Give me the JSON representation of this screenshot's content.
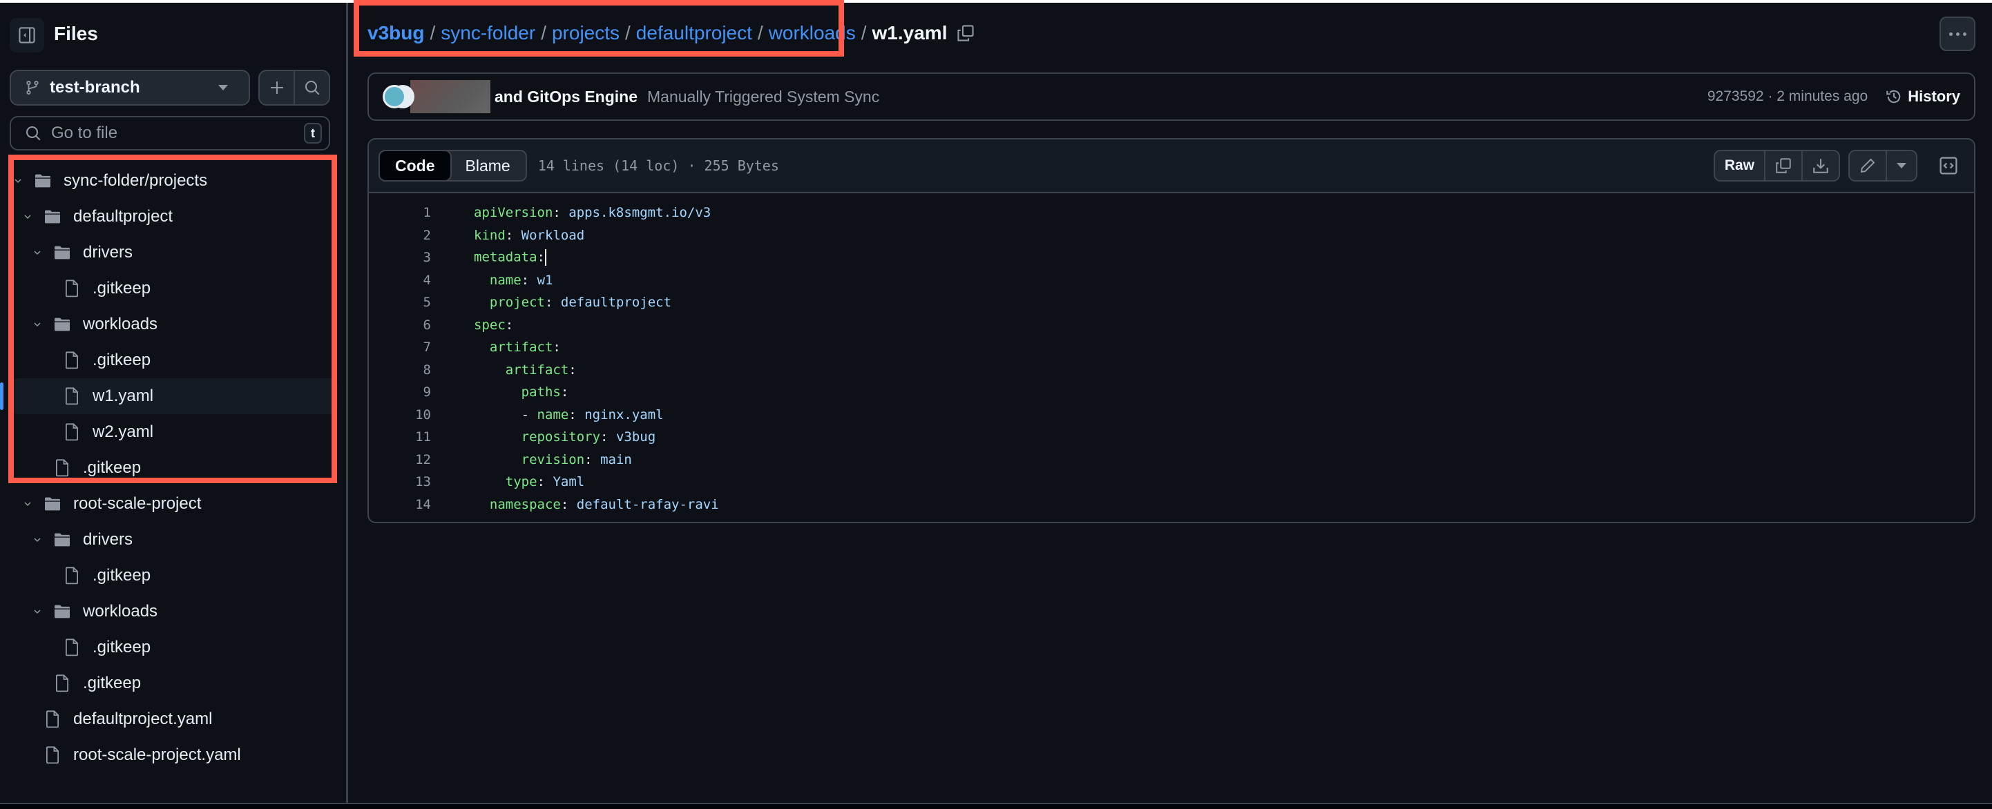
{
  "sidebar": {
    "title": "Files",
    "branch": "test-branch",
    "goto_placeholder": "Go to file",
    "goto_shortcut": "t",
    "tree": [
      {
        "name": "sync-folder/projects",
        "type": "folder",
        "depth": 0,
        "expanded": true
      },
      {
        "name": "defaultproject",
        "type": "folder",
        "depth": 1,
        "expanded": true
      },
      {
        "name": "drivers",
        "type": "folder",
        "depth": 2,
        "expanded": true
      },
      {
        "name": ".gitkeep",
        "type": "file",
        "depth": 3
      },
      {
        "name": "workloads",
        "type": "folder",
        "depth": 2,
        "expanded": true
      },
      {
        "name": ".gitkeep",
        "type": "file",
        "depth": 3
      },
      {
        "name": "w1.yaml",
        "type": "file",
        "depth": 3,
        "selected": true
      },
      {
        "name": "w2.yaml",
        "type": "file",
        "depth": 3
      },
      {
        "name": ".gitkeep",
        "type": "file",
        "depth": 2
      },
      {
        "name": "root-scale-project",
        "type": "folder",
        "depth": 1,
        "expanded": true
      },
      {
        "name": "drivers",
        "type": "folder",
        "depth": 2,
        "expanded": true
      },
      {
        "name": ".gitkeep",
        "type": "file",
        "depth": 3
      },
      {
        "name": "workloads",
        "type": "folder",
        "depth": 2,
        "expanded": true
      },
      {
        "name": ".gitkeep",
        "type": "file",
        "depth": 3
      },
      {
        "name": ".gitkeep",
        "type": "file",
        "depth": 2
      },
      {
        "name": "defaultproject.yaml",
        "type": "file",
        "depth": 1
      },
      {
        "name": "root-scale-project.yaml",
        "type": "file",
        "depth": 1
      }
    ]
  },
  "breadcrumb": {
    "items": [
      "v3bug",
      "sync-folder",
      "projects",
      "defaultproject",
      "workloads"
    ],
    "separator": "/",
    "current": "w1.yaml"
  },
  "commit": {
    "authors_text": "and GitOps Engine",
    "message": "Manually Triggered System Sync",
    "meta": "9273592 · 2 minutes ago",
    "history_label": "History"
  },
  "file": {
    "tabs": [
      "Code",
      "Blame"
    ],
    "active_tab": "Code",
    "info": "14 lines (14 loc) · 255 Bytes",
    "raw_label": "Raw",
    "lines": [
      {
        "n": "1",
        "indent": "",
        "key": "apiVersion",
        "value": "apps.k8smgmt.io/v3"
      },
      {
        "n": "2",
        "indent": "",
        "key": "kind",
        "value": "Workload"
      },
      {
        "n": "3",
        "indent": "",
        "key": "metadata",
        "value": "",
        "cursor": true
      },
      {
        "n": "4",
        "indent": "  ",
        "key": "name",
        "value": "w1"
      },
      {
        "n": "5",
        "indent": "  ",
        "key": "project",
        "value": "defaultproject"
      },
      {
        "n": "6",
        "indent": "",
        "key": "spec",
        "value": ""
      },
      {
        "n": "7",
        "indent": "  ",
        "key": "artifact",
        "value": ""
      },
      {
        "n": "8",
        "indent": "    ",
        "key": "artifact",
        "value": ""
      },
      {
        "n": "9",
        "indent": "      ",
        "key": "paths",
        "value": ""
      },
      {
        "n": "10",
        "indent": "      ",
        "dash": true,
        "key": "name",
        "value": "nginx.yaml"
      },
      {
        "n": "11",
        "indent": "      ",
        "key": "repository",
        "value": "v3bug"
      },
      {
        "n": "12",
        "indent": "      ",
        "key": "revision",
        "value": "main"
      },
      {
        "n": "13",
        "indent": "    ",
        "key": "type",
        "value": "Yaml"
      },
      {
        "n": "14",
        "indent": "  ",
        "key": "namespace",
        "value": "default-rafay-ravi"
      }
    ]
  },
  "colors": {
    "highlight": "#ff5a4a",
    "link": "#4493f8",
    "yaml_key": "#7ee787",
    "yaml_value": "#a5d6ff"
  }
}
